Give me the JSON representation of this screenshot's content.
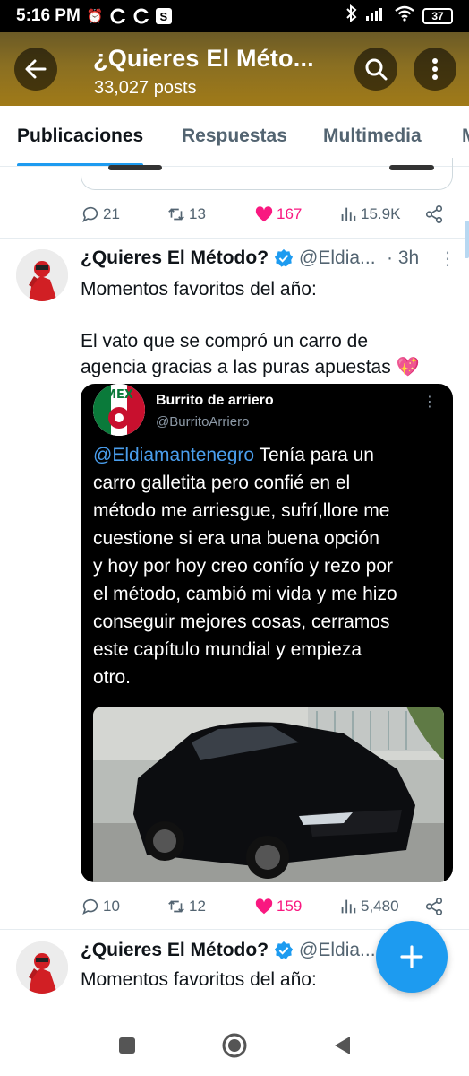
{
  "status_bar": {
    "time": "5:16 PM",
    "battery": "37"
  },
  "header": {
    "title": "¿Quieres El Méto...",
    "subtitle": "33,027 posts"
  },
  "tabs": [
    {
      "label": "Publicaciones",
      "active": true
    },
    {
      "label": "Respuestas",
      "active": false
    },
    {
      "label": "Multimedia",
      "active": false
    },
    {
      "label": "M",
      "active": false
    }
  ],
  "prev_tweet": {
    "replies": "21",
    "retweets": "13",
    "likes": "167",
    "views": "15.9K"
  },
  "tweet1": {
    "name": "¿Quieres El Método?",
    "handle": "@Eldia...",
    "time": "· 3h",
    "text_line1": "Momentos favoritos del año:",
    "text_line2": "El vato que se compró un carro de",
    "text_line3": "agencia gracias a las puras apuestas 💖",
    "embed": {
      "name": "Burrito de arriero",
      "handle": "@BurritoArriero",
      "mention": "@Eldiamantenegro",
      "text_first": " Tenía para un",
      "lines": [
        "carro galletita pero confié en el",
        "método me arriesgue, sufrí,llore me",
        "cuestione si era una buena opción",
        "y hoy por hoy creo confío y rezo por",
        "el método, cambió mi vida y me hizo",
        "conseguir mejores cosas, cerramos",
        "este capítulo mundial y empieza",
        "otro."
      ]
    },
    "replies": "10",
    "retweets": "12",
    "likes": "159",
    "views": "5,480"
  },
  "tweet2": {
    "name": "¿Quieres El Método?",
    "handle": "@Eldia...",
    "text_line1": "Momentos favoritos del año:"
  },
  "colors": {
    "accent": "#1d9bf0",
    "like": "#f91880",
    "muted": "#536471"
  }
}
